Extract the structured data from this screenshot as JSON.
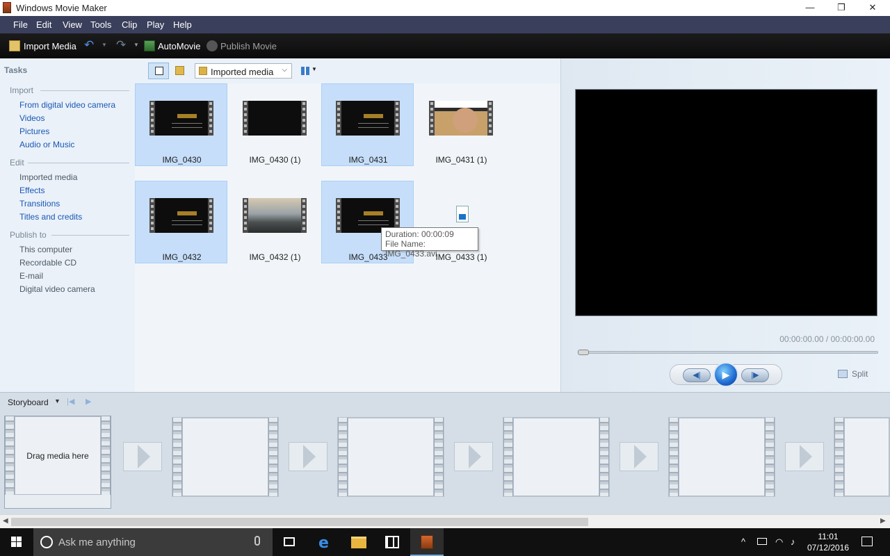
{
  "window": {
    "title": "Windows Movie Maker",
    "controls": {
      "minimize": "—",
      "restore": "❐",
      "close": "✕"
    }
  },
  "menu": [
    "File",
    "Edit",
    "View",
    "Tools",
    "Clip",
    "Play",
    "Help"
  ],
  "toolbar": {
    "import_media": "Import Media",
    "automovie": "AutoMovie",
    "publish_movie": "Publish Movie"
  },
  "tasks": {
    "header": "Tasks",
    "import": {
      "title": "Import",
      "items": [
        "From digital video camera",
        "Videos",
        "Pictures",
        "Audio or Music"
      ]
    },
    "edit": {
      "title": "Edit",
      "items": [
        "Imported media",
        "Effects",
        "Transitions",
        "Titles and credits"
      ]
    },
    "publish": {
      "title": "Publish to",
      "items": [
        "This computer",
        "Recordable CD",
        "E-mail",
        "Digital video camera"
      ]
    }
  },
  "content": {
    "folder": "Imported media",
    "media": [
      {
        "label": "IMG_0430",
        "selected": true,
        "kind": "title"
      },
      {
        "label": "IMG_0430 (1)",
        "selected": false,
        "kind": "dark"
      },
      {
        "label": "IMG_0431",
        "selected": true,
        "kind": "title"
      },
      {
        "label": "IMG_0431 (1)",
        "selected": false,
        "kind": "photo"
      },
      {
        "label": "IMG_0432",
        "selected": true,
        "kind": "title"
      },
      {
        "label": "IMG_0432 (1)",
        "selected": false,
        "kind": "sky"
      },
      {
        "label": "IMG_0433",
        "selected": true,
        "kind": "title"
      },
      {
        "label": "IMG_0433 (1)",
        "selected": false,
        "kind": "file"
      }
    ],
    "tooltip": {
      "duration": "Duration: 00:00:09",
      "filename": "File Name: IMG_0433.avi"
    }
  },
  "preview": {
    "timecode": "00:00:00.00 / 00:00:00.00",
    "position": 0,
    "split": "Split"
  },
  "storyboard": {
    "label": "Storyboard",
    "drag_hint": "Drag media here"
  },
  "taskbar": {
    "search_placeholder": "Ask me anything",
    "time": "11:01",
    "date": "07/12/2016"
  },
  "colors": {
    "menubar": "#3a3f5c",
    "toolbar": "#111111",
    "selection": "#c6defa",
    "link": "#1a57b4",
    "taskbar": "#101010"
  }
}
